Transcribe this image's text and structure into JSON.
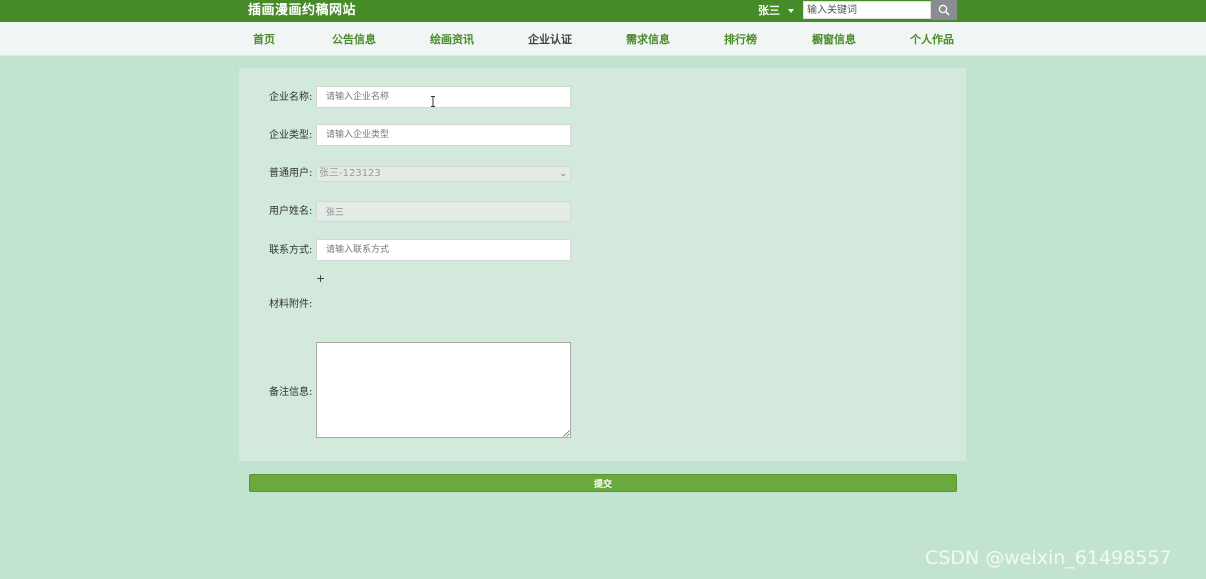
{
  "header": {
    "site_title": "插画漫画约稿网站",
    "user_name": "张三",
    "search": {
      "placeholder": "输入关键词",
      "value": ""
    }
  },
  "nav": [
    {
      "label": "首页",
      "active": false
    },
    {
      "label": "公告信息",
      "active": false
    },
    {
      "label": "绘画资讯",
      "active": false
    },
    {
      "label": "企业认证",
      "active": true
    },
    {
      "label": "需求信息",
      "active": false
    },
    {
      "label": "排行榜",
      "active": false
    },
    {
      "label": "橱窗信息",
      "active": false
    },
    {
      "label": "个人作品",
      "active": false
    }
  ],
  "form": {
    "company_name": {
      "label": "企业名称:",
      "placeholder": "请输入企业名称"
    },
    "company_type": {
      "label": "企业类型:",
      "placeholder": "请输入企业类型"
    },
    "normal_user": {
      "label": "普通用户:",
      "value": "张三-123123"
    },
    "user_realname": {
      "label": "用户姓名:",
      "value": "张三"
    },
    "contact": {
      "label": "联系方式:",
      "placeholder": "请输入联系方式"
    },
    "attachment": {
      "label": "材料附件:",
      "add_symbol": "+"
    },
    "remark": {
      "label": "备注信息:",
      "value": ""
    },
    "submit_label": "提交"
  },
  "watermark": "CSDN @weixin_61498557",
  "colors": {
    "topbar": "#458b27",
    "nav_bg": "#f1f6f4",
    "nav_text": "#4c8b2c",
    "page_bg": "#c2e3cf",
    "panel_bg": "#d3e9dc",
    "submit_bg": "#6aa93e"
  }
}
